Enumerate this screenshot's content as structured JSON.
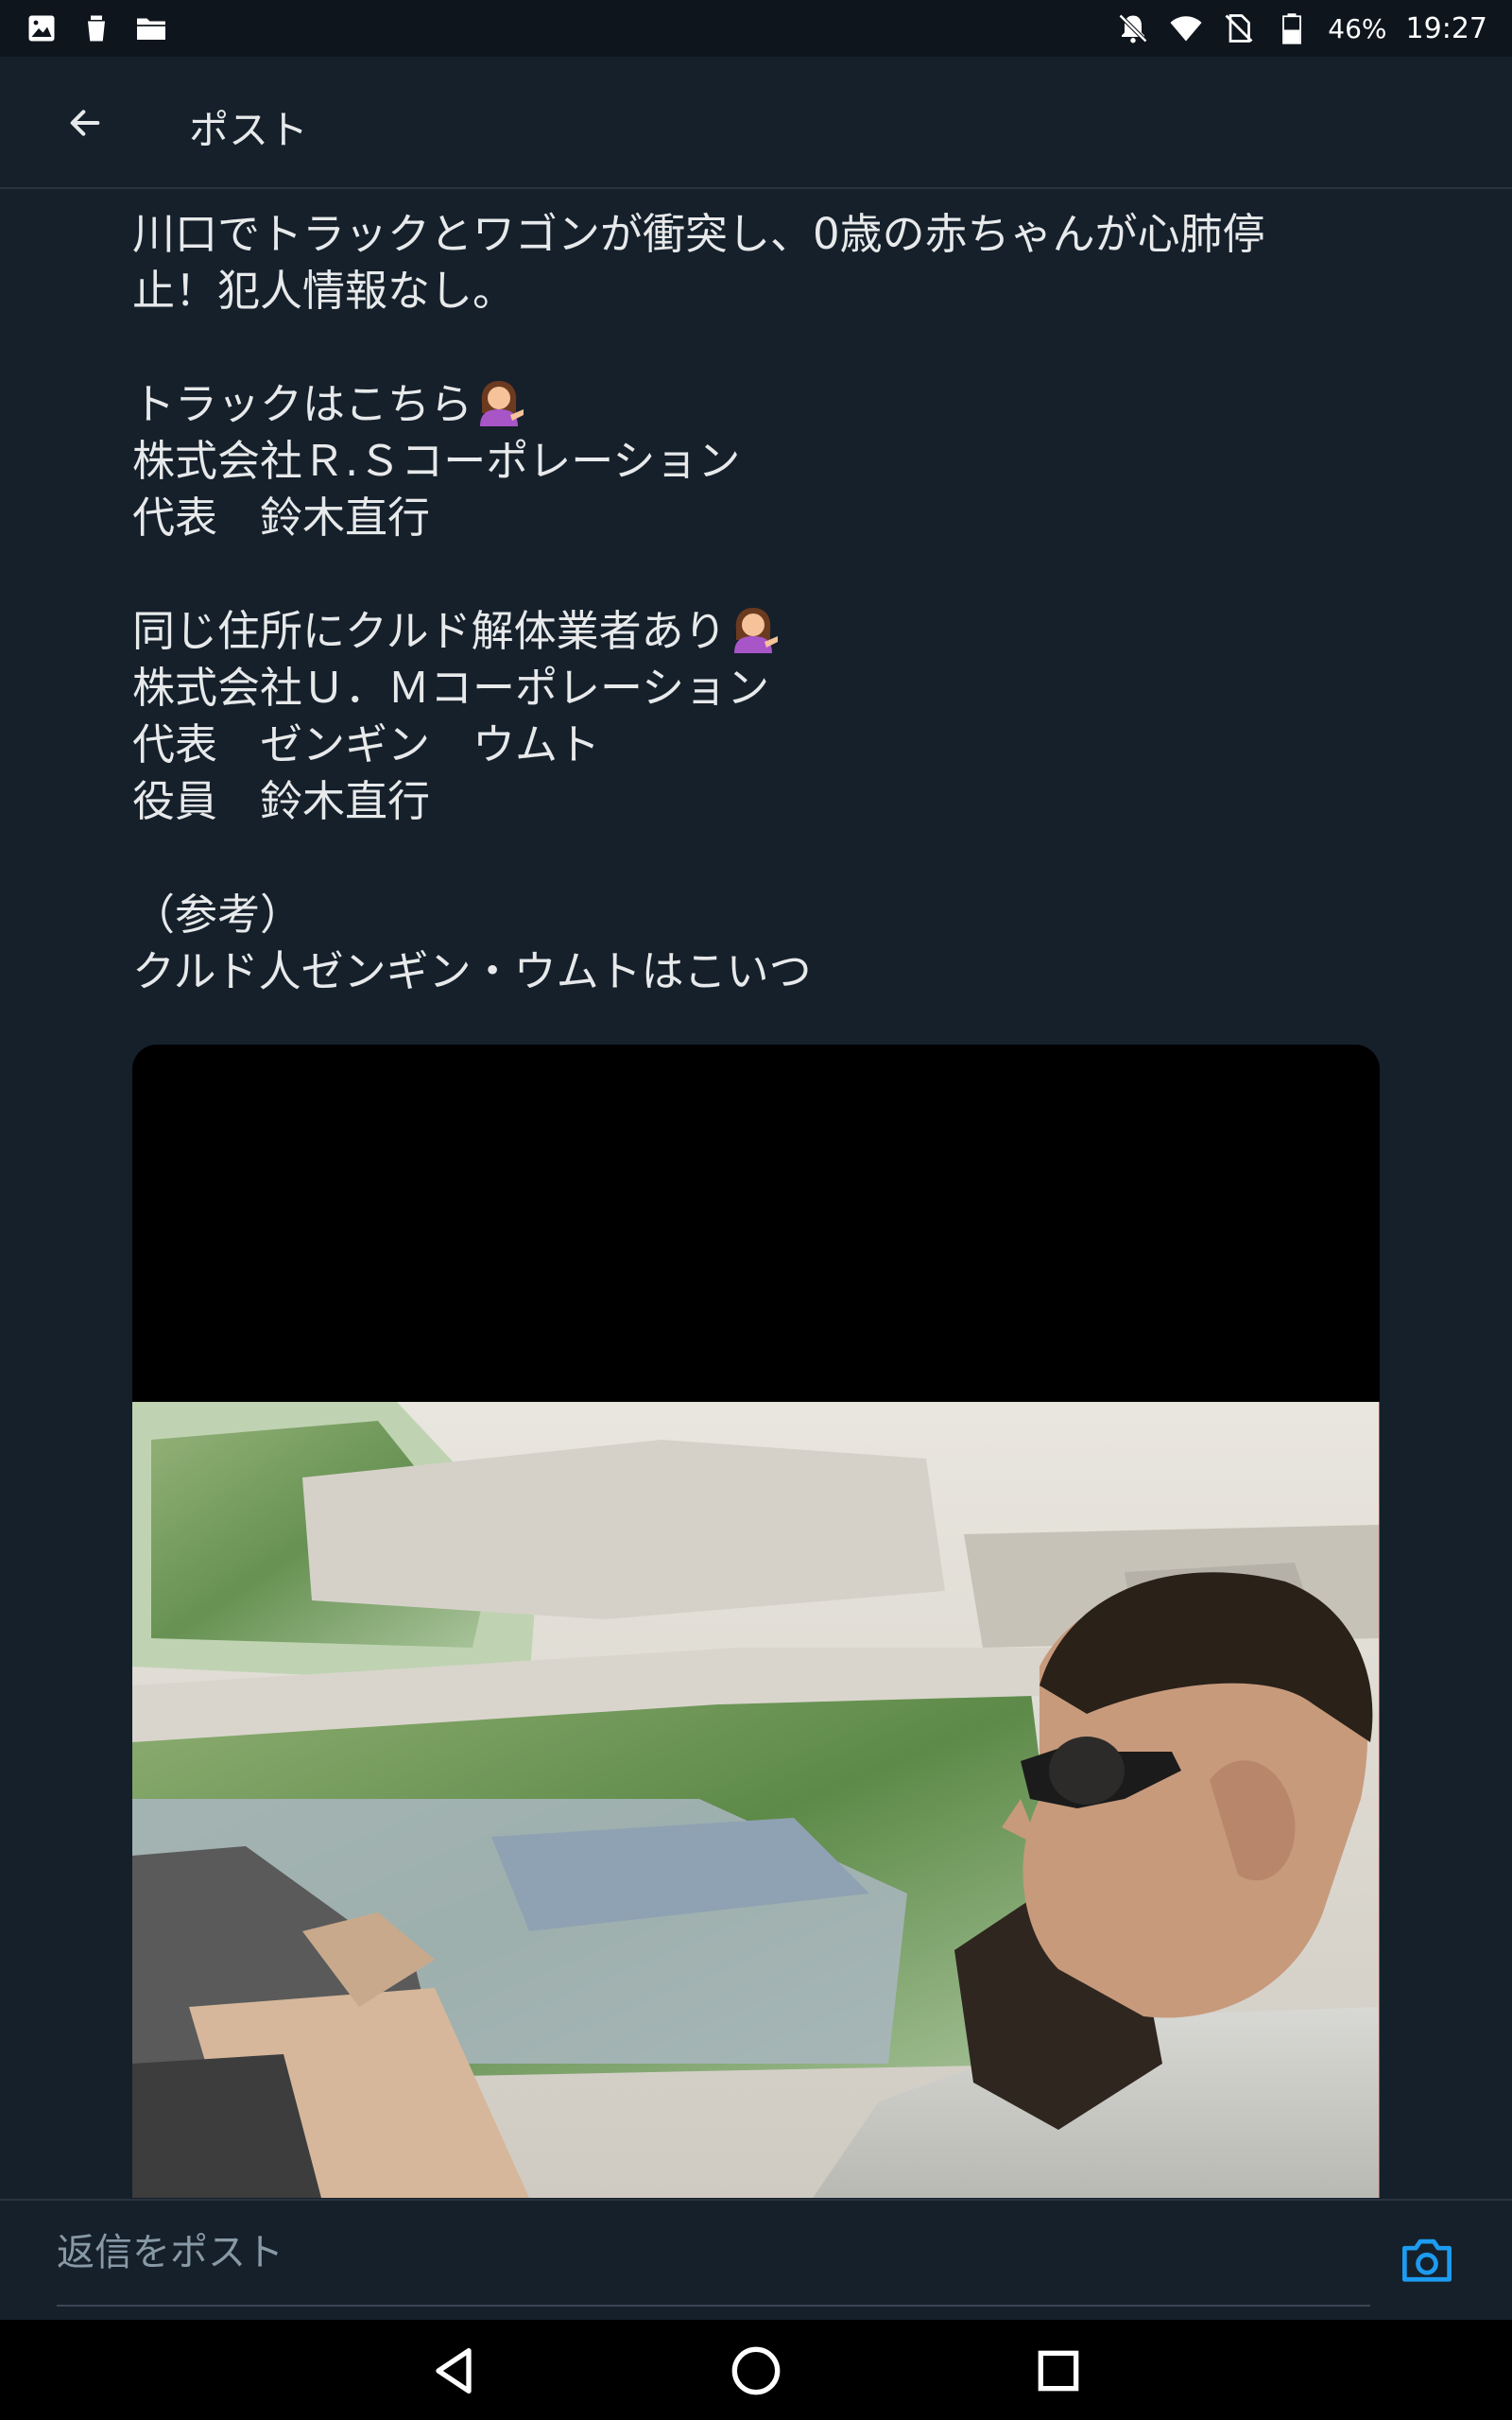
{
  "status_bar": {
    "battery": "46%",
    "time": "19:27",
    "left_icons": [
      "image-icon",
      "cup-icon",
      "folder-icon"
    ],
    "right_icons": [
      "bell-off-icon",
      "wifi-icon",
      "no-sim-icon",
      "battery-icon"
    ]
  },
  "header": {
    "title": "ポスト",
    "back_icon": "arrow-left-icon"
  },
  "tweet": {
    "lines": [
      "川口でトラックとワゴンが衝突し、0歳の赤ちゃんが心肺停",
      "止！犯人情報なし。",
      "",
      "トラックはこちら",
      "株式会社Ｒ.Ｓコーポレーション",
      "代表　鈴木直行",
      "",
      "同じ住所にクルド解体業者あり",
      "株式会社Ｕ．Ｍコーポレーション",
      "代表　ゼンギン　ウムト",
      "役員　鈴木直行",
      "",
      "（参考）",
      "クルド人ゼンギン・ウムトはこいつ"
    ],
    "emoji": "woman-tipping-hand-emoji"
  },
  "media": {
    "type": "photo",
    "subject": "man-driving-car-photo"
  },
  "reply": {
    "placeholder": "返信をポスト",
    "camera_icon": "camera-icon"
  },
  "nav": {
    "icons": [
      "back-triangle-icon",
      "home-circle-icon",
      "recents-square-icon"
    ]
  },
  "colors": {
    "background": "#15202b",
    "status_bar": "#0f151d",
    "text": "#e7e9ea",
    "placeholder": "#8899a6",
    "accent": "#1d9bf0"
  }
}
